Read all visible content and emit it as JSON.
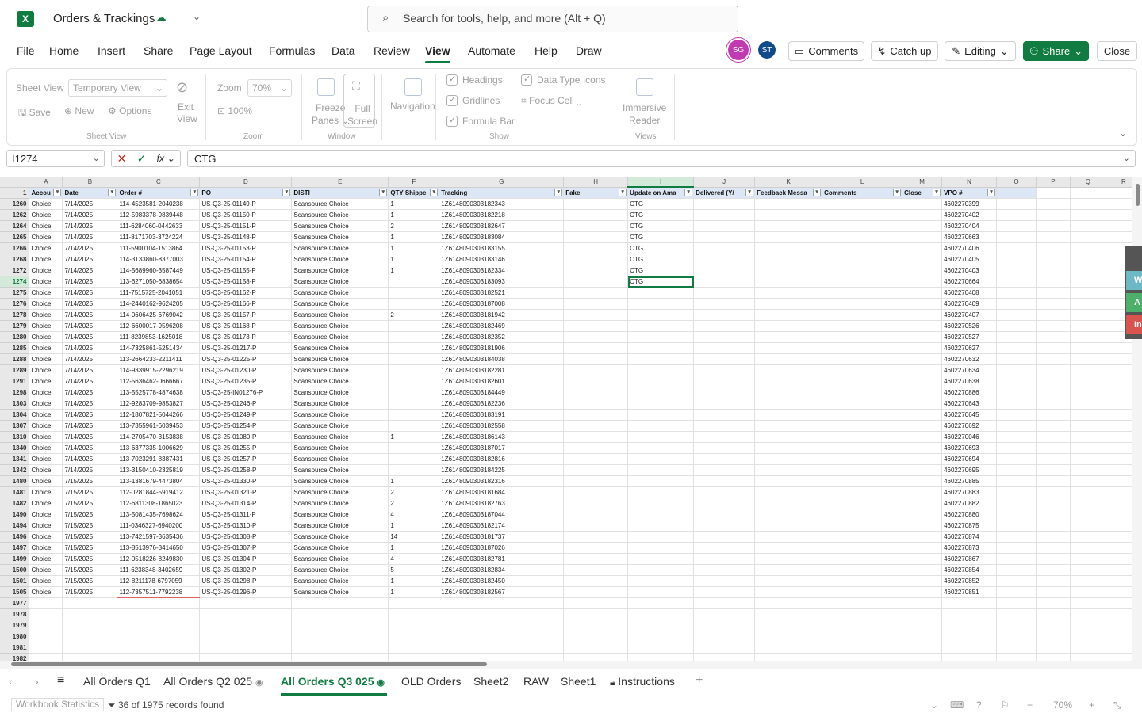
{
  "title": {
    "app_letter": "X",
    "doc": "Orders & Trackings",
    "search_placeholder": "Search for tools, help, and more (Alt + Q)"
  },
  "menu": [
    "File",
    "Home",
    "Insert",
    "Share",
    "Page Layout",
    "Formulas",
    "Data",
    "Review",
    "View",
    "Automate",
    "Help",
    "Draw"
  ],
  "users": [
    "SG",
    "ST"
  ],
  "buttons": {
    "comments": "Comments",
    "catchup": "Catch up",
    "editing": "Editing",
    "share": "Share",
    "close": "Close"
  },
  "ribbon": {
    "sheet_view_label": "Sheet View",
    "sheet_view_value": "Temporary View",
    "exit_view": "Exit View",
    "save": "Save",
    "new": "New",
    "options": "Options",
    "group_sheet_view": "Sheet View",
    "zoom_label": "Zoom",
    "zoom_value": "70%",
    "zoom_100": "100%",
    "group_zoom": "Zoom",
    "freeze_1": "Freeze",
    "freeze_2": "Panes",
    "full_1": "Full",
    "full_2": "Screen",
    "group_window": "Window",
    "navigation": "Navigation",
    "headings": "Headings",
    "gridlines": "Gridlines",
    "formula_bar": "Formula Bar",
    "data_type_icons": "Data Type Icons",
    "focus_cell": "Focus Cell",
    "group_show": "Show",
    "immersive_1": "Immersive",
    "immersive_2": "Reader",
    "group_views": "Views"
  },
  "formula_bar": {
    "cell": "I1274",
    "value": "CTG"
  },
  "grid": {
    "columns": [
      "A",
      "B",
      "C",
      "D",
      "E",
      "F",
      "G",
      "H",
      "I",
      "J",
      "K",
      "L",
      "M",
      "N",
      "O",
      "P",
      "Q",
      "R"
    ],
    "header_row": "1",
    "headers": [
      "Accou",
      "Date",
      "Order #",
      "PO",
      "DISTI",
      "QTY Shippe",
      "Tracking",
      "Fake",
      "Update on Ama",
      "Delivered (Y/",
      "Feedback Messa",
      "Comments",
      "Close",
      "VPO #"
    ],
    "rows": [
      [
        "1260",
        "Choice",
        "7/14/2025",
        "114-4523581-2040238",
        "US-Q3-25-01149-P",
        "Scansource Choice",
        "1",
        "1Z6148090303182343",
        "",
        "CTG",
        "4602270399"
      ],
      [
        "1262",
        "Choice",
        "7/14/2025",
        "112-5983378-9839448",
        "US-Q3-25-01150-P",
        "Scansource Choice",
        "1",
        "1Z6148090303182218",
        "",
        "CTG",
        "4602270402"
      ],
      [
        "1264",
        "Choice",
        "7/14/2025",
        "111-6284060-0442633",
        "US-Q3-25-01151-P",
        "Scansource Choice",
        "2",
        "1Z6148090303182647",
        "",
        "CTG",
        "4602270404"
      ],
      [
        "1265",
        "Choice",
        "7/14/2025",
        "111-8171703-3724224",
        "US-Q3-25-01148-P",
        "Scansource Choice",
        "1",
        "1Z6148090303183084",
        "",
        "CTG",
        "4602270663"
      ],
      [
        "1266",
        "Choice",
        "7/14/2025",
        "111-5900104-1513864",
        "US-Q3-25-01153-P",
        "Scansource Choice",
        "1",
        "1Z6148090303183155",
        "",
        "CTG",
        "4602270406"
      ],
      [
        "1268",
        "Choice",
        "7/14/2025",
        "114-3133860-8377003",
        "US-Q3-25-01154-P",
        "Scansource Choice",
        "1",
        "1Z6148090303183146",
        "",
        "CTG",
        "4602270405"
      ],
      [
        "1272",
        "Choice",
        "7/14/2025",
        "114-5689960-3587449",
        "US-Q3-25-01155-P",
        "Scansource Choice",
        "1",
        "1Z6148090303182334",
        "",
        "CTG",
        "4602270403"
      ],
      [
        "1274",
        "Choice",
        "7/14/2025",
        "113-6271050-6838654",
        "US-Q3-25-01158-P",
        "Scansource Choice",
        "",
        "1Z6148090303183093",
        "",
        "CTG",
        "4602270664"
      ],
      [
        "1275",
        "Choice",
        "7/14/2025",
        "111-7515725-2041051",
        "US-Q3-25-01162-P",
        "Scansource Choice",
        "",
        "1Z6148090303182521",
        "",
        "",
        "4602270408"
      ],
      [
        "1276",
        "Choice",
        "7/14/2025",
        "114-2440162-9624205",
        "US-Q3-25-01166-P",
        "Scansource Choice",
        "",
        "1Z6148090303187008",
        "",
        "",
        "4602270409"
      ],
      [
        "1278",
        "Choice",
        "7/14/2025",
        "114-0606425-6769042",
        "US-Q3-25-01157-P",
        "Scansource Choice",
        "2",
        "1Z6148090303181942",
        "",
        "",
        "4602270407"
      ],
      [
        "1279",
        "Choice",
        "7/14/2025",
        "112-6600017-9596208",
        "US-Q3-25-01168-P",
        "Scansource Choice",
        "",
        "1Z6148090303182469",
        "",
        "",
        "4602270526"
      ],
      [
        "1280",
        "Choice",
        "7/14/2025",
        "111-8239853-1625018",
        "US-Q3-25-01173-P",
        "Scansource Choice",
        "",
        "1Z6148090303182352",
        "",
        "",
        "4602270527"
      ],
      [
        "1285",
        "Choice",
        "7/14/2025",
        "114-7325861-5251434",
        "US-Q3-25-01217-P",
        "Scansource Choice",
        "",
        "1Z6148090303181906",
        "",
        "",
        "4602270627"
      ],
      [
        "1288",
        "Choice",
        "7/14/2025",
        "113-2664233-2211411",
        "US-Q3-25-01225-P",
        "Scansource Choice",
        "",
        "1Z6148090303184038",
        "",
        "",
        "4602270632"
      ],
      [
        "1289",
        "Choice",
        "7/14/2025",
        "114-9339915-2296219",
        "US-Q3-25-01230-P",
        "Scansource Choice",
        "",
        "1Z6148090303182281",
        "",
        "",
        "4602270634"
      ],
      [
        "1291",
        "Choice",
        "7/14/2025",
        "112-5636462-0666667",
        "US-Q3-25-01235-P",
        "Scansource Choice",
        "",
        "1Z6148090303182601",
        "",
        "",
        "4602270638"
      ],
      [
        "1298",
        "Choice",
        "7/14/2025",
        "113-5525778-4874638",
        "US-Q3-25-IN01276-P",
        "Scansource Choice",
        "",
        "1Z6148090303184449",
        "",
        "",
        "4602270886"
      ],
      [
        "1303",
        "Choice",
        "7/14/2025",
        "112-9283709-9853827",
        "US-Q3-25-01246-P",
        "Scansource Choice",
        "",
        "1Z6148090303182236",
        "",
        "",
        "4602270643"
      ],
      [
        "1304",
        "Choice",
        "7/14/2025",
        "112-1807821-5044266",
        "US-Q3-25-01249-P",
        "Scansource Choice",
        "",
        "1Z6148090303183191",
        "",
        "",
        "4602270645"
      ],
      [
        "1307",
        "Choice",
        "7/14/2025",
        "113-7355961-6039453",
        "US-Q3-25-01254-P",
        "Scansource Choice",
        "",
        "1Z6148090303182558",
        "",
        "",
        "4602270692"
      ],
      [
        "1310",
        "Choice",
        "7/14/2025",
        "114-2705470-3153838",
        "US-Q3-25-01080-P",
        "Scansource Choice",
        "1",
        "1Z6148090303186143",
        "",
        "",
        "4602270046"
      ],
      [
        "1340",
        "Choice",
        "7/14/2025",
        "113-6377335-1006629",
        "US-Q3-25-01255-P",
        "Scansource Choice",
        "",
        "1Z6148090303187017",
        "",
        "",
        "4602270693"
      ],
      [
        "1341",
        "Choice",
        "7/14/2025",
        "113-7023291-8387431",
        "US-Q3-25-01257-P",
        "Scansource Choice",
        "",
        "1Z6148090303182816",
        "",
        "",
        "4602270694"
      ],
      [
        "1342",
        "Choice",
        "7/14/2025",
        "113-3150410-2325819",
        "US-Q3-25-01258-P",
        "Scansource Choice",
        "",
        "1Z6148090303184225",
        "",
        "",
        "4602270695"
      ],
      [
        "1480",
        "Choice",
        "7/15/2025",
        "113-1381679-4473804",
        "US-Q3-25-01330-P",
        "Scansource Choice",
        "1",
        "1Z6148090303182316",
        "",
        "",
        "4602270885"
      ],
      [
        "1481",
        "Choice",
        "7/15/2025",
        "112-0281844-5919412",
        "US-Q3-25-01321-P",
        "Scansource Choice",
        "2",
        "1Z6148090303181684",
        "",
        "",
        "4602270883"
      ],
      [
        "1482",
        "Choice",
        "7/15/2025",
        "112-6811308-1865023",
        "US-Q3-25-01314-P",
        "Scansource Choice",
        "2",
        "1Z6148090303182763",
        "",
        "",
        "4602270882"
      ],
      [
        "1490",
        "Choice",
        "7/15/2025",
        "113-5081435-7698624",
        "US-Q3-25-01311-P",
        "Scansource Choice",
        "4",
        "1Z6148090303187044",
        "",
        "",
        "4602270880"
      ],
      [
        "1494",
        "Choice",
        "7/15/2025",
        "111-0346327-6940200",
        "US-Q3-25-01310-P",
        "Scansource Choice",
        "1",
        "1Z6148090303182174",
        "",
        "",
        "4602270875"
      ],
      [
        "1496",
        "Choice",
        "7/15/2025",
        "113-7421597-3635436",
        "US-Q3-25-01308-P",
        "Scansource Choice",
        "14",
        "1Z6148090303181737",
        "",
        "",
        "4602270874"
      ],
      [
        "1497",
        "Choice",
        "7/15/2025",
        "113-8513976-3414650",
        "US-Q3-25-01307-P",
        "Scansource Choice",
        "1",
        "1Z6148090303187026",
        "",
        "",
        "4602270873"
      ],
      [
        "1499",
        "Choice",
        "7/15/2025",
        "112-0518226-8249830",
        "US-Q3-25-01304-P",
        "Scansource Choice",
        "4",
        "1Z6148090303182781",
        "",
        "",
        "4602270867"
      ],
      [
        "1500",
        "Choice",
        "7/15/2025",
        "111-6238348-3402659",
        "US-Q3-25-01302-P",
        "Scansource Choice",
        "5",
        "1Z6148090303182834",
        "",
        "",
        "4602270854"
      ],
      [
        "1501",
        "Choice",
        "7/15/2025",
        "112-8211178-6797059",
        "US-Q3-25-01298-P",
        "Scansource Choice",
        "1",
        "1Z6148090303182450",
        "",
        "",
        "4602270852"
      ],
      [
        "1505",
        "Choice",
        "7/15/2025",
        "112-7357511-7792238",
        "US-Q3-25-01296-P",
        "Scansource Choice",
        "1",
        "1Z6148090303182567",
        "",
        "",
        "4602270851"
      ]
    ],
    "empty_rows": [
      "1977",
      "1978",
      "1979",
      "1980",
      "1981",
      "1982"
    ],
    "active_row": "1274"
  },
  "side_tabs": [
    "W",
    "A",
    "In"
  ],
  "sheets": [
    "All Orders Q1",
    "All Orders Q2 025",
    "All Orders Q3 025",
    "OLD Orders",
    "Sheet2",
    "RAW",
    "Sheet1",
    "Instructions"
  ],
  "status": {
    "workbook_stats": "Workbook Statistics",
    "records": "36 of 1975 records found",
    "zoom": "70%"
  },
  "colors": {
    "accent": "#107c41",
    "header_fill": "#dce6f4"
  }
}
